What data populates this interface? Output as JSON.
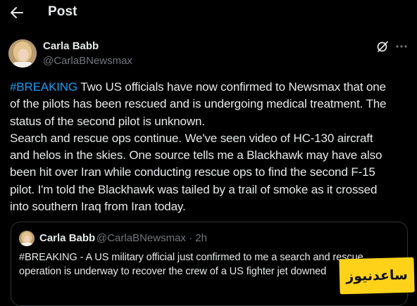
{
  "header": {
    "back_icon": "arrow-left-icon",
    "title": "Post"
  },
  "post": {
    "author": {
      "name": "Carla Babb",
      "handle": "@CarlaBNewsmax"
    },
    "actions": {
      "grok_icon": "grok-slash-circle-icon",
      "more_icon": "more-horizontal-icon"
    },
    "body": {
      "hashtag": "#BREAKING",
      "line1_rest": " Two US officials have now confirmed to Newsmax that one",
      "line2": "of the pilots has been rescued and is undergoing medical treatment. The",
      "line3": "status of the second pilot is unknown.",
      "line4": "Search and rescue ops continue. We've seen video of HC-130 aircraft",
      "line5": "and helos in the skies. One source tells me a Blackhawk may have also",
      "line6": "been hit over Iran while conducting rescue ops to find the second F-15",
      "line7": "pilot. I'm told the Blackhawk was tailed by a trail of smoke as it crossed",
      "line8": "into southern Iraq from Iran today."
    }
  },
  "quote": {
    "author_name": "Carla Babb",
    "meta": "@CarlaBNewsmax · 2h",
    "line1": "#BREAKING - A US military official just confirmed to me a search and rescue",
    "line2": "operation is underway to recover the crew of a US fighter jet downed"
  },
  "watermark": {
    "text": "ساعدنیوز",
    "color": "#ffd21a"
  },
  "colors": {
    "background": "#000000",
    "text": "#e7e9ea",
    "secondary": "#71767b",
    "link": "#1d9bf0",
    "border": "#2f3336"
  }
}
